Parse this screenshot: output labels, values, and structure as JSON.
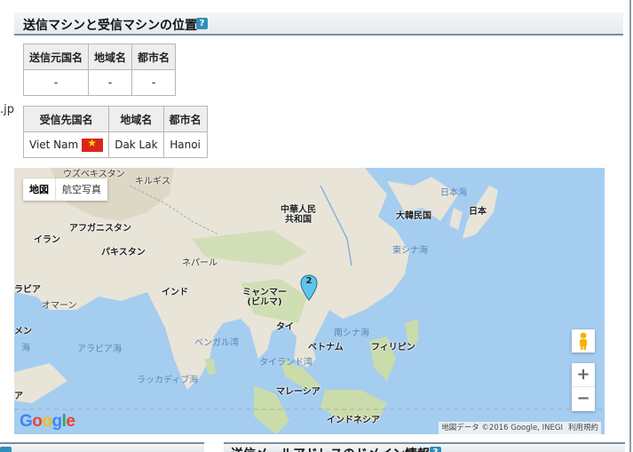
{
  "section": {
    "title": "送信マシンと受信マシンの位置",
    "help": "?"
  },
  "side_text": ".jp",
  "sender_table": {
    "headers": [
      "送信元国名",
      "地域名",
      "都市名"
    ],
    "row": [
      "-",
      "-",
      "-"
    ]
  },
  "receiver_table": {
    "headers": [
      "受信先国名",
      "地域名",
      "都市名"
    ],
    "row": [
      "Viet Nam",
      "Dak Lak",
      "Hanoi"
    ]
  },
  "map": {
    "type_buttons": [
      "地図",
      "航空写真"
    ],
    "marker_count": "2",
    "labels": {
      "china": "中華人民\n共和国",
      "korea": "大韓民国",
      "japan": "日本",
      "japan_sea": "日本海",
      "east_china_sea": "東シナ海",
      "afghanistan": "アフガニスタン",
      "uzbekistan": "ウズベキスタン",
      "kyrgyzstan": "キルギス",
      "iran": "イラン",
      "pakistan": "パキスタン",
      "nepal": "ネパール",
      "india": "インド",
      "arabia": "ラビア",
      "oman": "オマーン",
      "yemen": "メン",
      "sea_left": "海",
      "myanmar": "ミャンマー\n(ビルマ)",
      "thailand": "タイ",
      "vietnam": "ベトナム",
      "philippines": "フィリピン",
      "south_china_sea": "南シナ海",
      "bay_of_bengal": "ベンガル湾",
      "arabian_sea": "アラビア海",
      "gulf_of_thailand": "タイランド湾",
      "laccadive_sea": "ラッカディブ海",
      "malaysia": "マレーシア",
      "indonesia": "インドネシア",
      "edge_a": "ア"
    },
    "zoom_in": "+",
    "zoom_out": "−",
    "logo": "Google",
    "attribution": "地図データ ©2016 Google, INEGI",
    "terms": "利用規約"
  },
  "bottom": {
    "right_title": "送信メールアドレスのドメイン情報",
    "help": "?"
  },
  "colors": {
    "water": "#a5cdf0",
    "land": "#e8e4d8",
    "forest": "#c9dcaa",
    "accent": "#2f8fb9",
    "header_border": "#7d8d99"
  }
}
